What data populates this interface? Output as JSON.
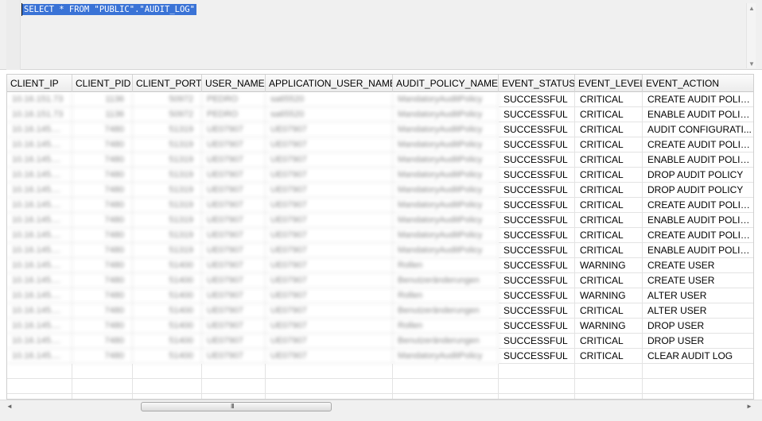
{
  "editor": {
    "sql": "SELECT * FROM \"PUBLIC\".\"AUDIT_LOG\""
  },
  "grid": {
    "columns": [
      "CLIENT_IP",
      "CLIENT_PID",
      "CLIENT_PORT",
      "USER_NAME",
      "APPLICATION_USER_NAME",
      "AUDIT_POLICY_NAME",
      "EVENT_STATUS",
      "EVENT_LEVEL",
      "EVENT_ACTION"
    ],
    "rows": [
      [
        "10.16.151.73",
        "1136",
        "50972",
        "PEDRO",
        "sa65520",
        "MandatoryAuditPolicy",
        "SUCCESSFUL",
        "CRITICAL",
        "CREATE AUDIT POLICY"
      ],
      [
        "10.16.151.73",
        "1136",
        "50972",
        "PEDRO",
        "sa65520",
        "MandatoryAuditPolicy",
        "SUCCESSFUL",
        "CRITICAL",
        "ENABLE AUDIT POLICY"
      ],
      [
        "10.16.145....",
        "7480",
        "51319",
        "UE07907",
        "UE07907",
        "MandatoryAuditPolicy",
        "SUCCESSFUL",
        "CRITICAL",
        "AUDIT CONFIGURATI..."
      ],
      [
        "10.16.145....",
        "7480",
        "51319",
        "UE07907",
        "UE07907",
        "MandatoryAuditPolicy",
        "SUCCESSFUL",
        "CRITICAL",
        "CREATE AUDIT POLICY"
      ],
      [
        "10.16.145....",
        "7480",
        "51319",
        "UE07907",
        "UE07907",
        "MandatoryAuditPolicy",
        "SUCCESSFUL",
        "CRITICAL",
        "ENABLE AUDIT POLICY"
      ],
      [
        "10.16.145....",
        "7480",
        "51319",
        "UE07907",
        "UE07907",
        "MandatoryAuditPolicy",
        "SUCCESSFUL",
        "CRITICAL",
        "DROP AUDIT POLICY"
      ],
      [
        "10.16.145....",
        "7480",
        "51319",
        "UE07907",
        "UE07907",
        "MandatoryAuditPolicy",
        "SUCCESSFUL",
        "CRITICAL",
        "DROP AUDIT POLICY"
      ],
      [
        "10.16.145....",
        "7480",
        "51319",
        "UE07907",
        "UE07907",
        "MandatoryAuditPolicy",
        "SUCCESSFUL",
        "CRITICAL",
        "CREATE AUDIT POLICY"
      ],
      [
        "10.16.145....",
        "7480",
        "51319",
        "UE07907",
        "UE07907",
        "MandatoryAuditPolicy",
        "SUCCESSFUL",
        "CRITICAL",
        "ENABLE AUDIT POLICY"
      ],
      [
        "10.16.145....",
        "7480",
        "51319",
        "UE07907",
        "UE07907",
        "MandatoryAuditPolicy",
        "SUCCESSFUL",
        "CRITICAL",
        "CREATE AUDIT POLICY"
      ],
      [
        "10.16.145....",
        "7480",
        "51319",
        "UE07907",
        "UE07907",
        "MandatoryAuditPolicy",
        "SUCCESSFUL",
        "CRITICAL",
        "ENABLE AUDIT POLICY"
      ],
      [
        "10.16.145....",
        "7480",
        "51400",
        "UE07907",
        "UE07907",
        "Rollen",
        "SUCCESSFUL",
        "WARNING",
        "CREATE USER"
      ],
      [
        "10.16.145....",
        "7480",
        "51400",
        "UE07907",
        "UE07907",
        "Benutzeränderungen",
        "SUCCESSFUL",
        "CRITICAL",
        "CREATE USER"
      ],
      [
        "10.16.145....",
        "7480",
        "51400",
        "UE07907",
        "UE07907",
        "Rollen",
        "SUCCESSFUL",
        "WARNING",
        "ALTER USER"
      ],
      [
        "10.16.145....",
        "7480",
        "51400",
        "UE07907",
        "UE07907",
        "Benutzeränderungen",
        "SUCCESSFUL",
        "CRITICAL",
        "ALTER USER"
      ],
      [
        "10.16.145....",
        "7480",
        "51400",
        "UE07907",
        "UE07907",
        "Rollen",
        "SUCCESSFUL",
        "WARNING",
        "DROP USER"
      ],
      [
        "10.16.145....",
        "7480",
        "51400",
        "UE07907",
        "UE07907",
        "Benutzeränderungen",
        "SUCCESSFUL",
        "CRITICAL",
        "DROP USER"
      ],
      [
        "10.16.145....",
        "7480",
        "51400",
        "UE07907",
        "UE07907",
        "MandatoryAuditPolicy",
        "SUCCESSFUL",
        "CRITICAL",
        "CLEAR AUDIT LOG"
      ]
    ],
    "empty_rows": 3
  },
  "scrollbar": {
    "grip": "III"
  },
  "icons": {
    "up": "scroll-up-arrow-icon",
    "down": "scroll-down-arrow-icon",
    "left": "scroll-left-arrow-icon",
    "right": "scroll-right-arrow-icon"
  }
}
